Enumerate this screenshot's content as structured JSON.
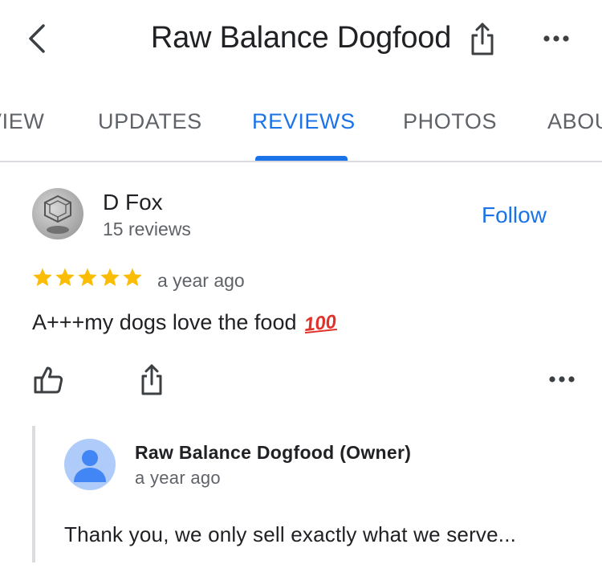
{
  "header": {
    "title": "Raw Balance Dogfood",
    "back_icon": "chevron-left-icon",
    "share_icon": "share-icon",
    "more_icon": "more-horizontal-icon"
  },
  "tabs": [
    {
      "label": "VIEW",
      "active": false
    },
    {
      "label": "UPDATES",
      "active": false
    },
    {
      "label": "REVIEWS",
      "active": true
    },
    {
      "label": "PHOTOS",
      "active": false
    },
    {
      "label": "ABOU",
      "active": false
    }
  ],
  "review": {
    "reviewer_name": "D Fox",
    "reviewer_count": "15 reviews",
    "follow_label": "Follow",
    "rating": 5,
    "time": "a year ago",
    "text": "A+++my dogs love the food",
    "emoji": "100"
  },
  "reply": {
    "owner_name": "Raw Balance Dogfood (Owner)",
    "time": "a year ago",
    "text": "Thank you, we only sell exactly what we serve..."
  },
  "colors": {
    "accent": "#1a73e8",
    "star": "#fbbc04",
    "text_primary": "#202124",
    "text_secondary": "#5f6368",
    "divider": "#dadce0",
    "emoji_red": "#e0322b"
  }
}
